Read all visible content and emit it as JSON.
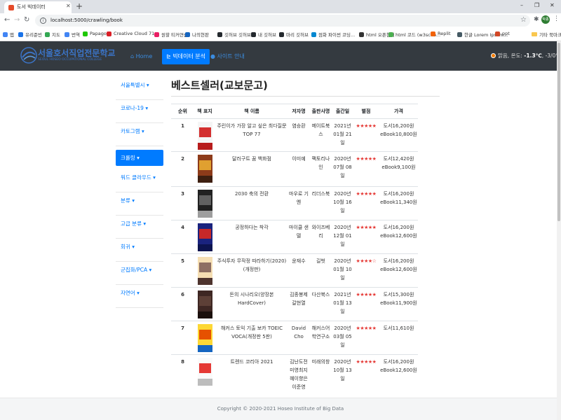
{
  "browser": {
    "tab_title": "도서 빅데이터",
    "url": "localhost:5000/crawling/book",
    "profile_initials": "박종",
    "window_controls": [
      "–",
      "❐",
      "✕"
    ],
    "bookmarks": [
      {
        "label": "앱",
        "color": "#4285f4"
      },
      {
        "label": "유리준빈",
        "color": "#1a73e8"
      },
      {
        "label": "지도",
        "color": "#34a853"
      },
      {
        "label": "번역",
        "color": "#4285f4"
      },
      {
        "label": "Papago",
        "color": "#1ec800"
      },
      {
        "label": "Creative Cloud 71...",
        "color": "#da1f26"
      },
      {
        "label": "원할 티커연습",
        "color": "#e91e63"
      },
      {
        "label": "나의현판",
        "color": "#1565c0"
      },
      {
        "label": "깃허브 깃허브",
        "color": "#24292e"
      },
      {
        "label": "내 깃허브",
        "color": "#24292e"
      },
      {
        "label": "마리 깃허브",
        "color": "#24292e"
      },
      {
        "label": "점화 파이썬 코딩...",
        "color": "#0288d1"
      },
      {
        "label": "html 오픈참서",
        "color": "#333333"
      },
      {
        "label": "html 코드 (w3scho...",
        "color": "#4caf50"
      },
      {
        "label": "Replit",
        "color": "#f26207"
      },
      {
        "label": "한글 Lorem Ipsum...",
        "color": "#455a64"
      },
      {
        "label": "ppt",
        "color": "#d24726"
      },
      {
        "label": "기타 북마크",
        "color": "#f9c74f"
      }
    ]
  },
  "app": {
    "brand_name": "서울호서직업전문학교",
    "brand_sub": "SEOUL HOSEO OCCUPATIONAL COLLEGE",
    "nav": [
      {
        "label": "Home",
        "icon": "home-icon",
        "active": false
      },
      {
        "label": "빅데이터 분석",
        "icon": "chart-icon",
        "active": true
      },
      {
        "label": "사이트 안내",
        "icon": "info-icon",
        "active": false
      }
    ],
    "weather": {
      "prefix": "맑음, 온도:",
      "value": "-1.3℃",
      "range": "-3/0℃"
    }
  },
  "sidebar": {
    "items": [
      {
        "label": "서울특별시",
        "active": false
      },
      {
        "label": "코로나-19",
        "active": false
      },
      {
        "label": "카토그램",
        "active": false
      },
      {
        "label": "크롤링",
        "active": true
      },
      {
        "label": "워드 클라우드",
        "active": false
      },
      {
        "label": "분류",
        "active": false
      },
      {
        "label": "고급 분류",
        "active": false
      },
      {
        "label": "회귀",
        "active": false
      },
      {
        "label": "군집화/PCA",
        "active": false
      },
      {
        "label": "자연어",
        "active": false
      }
    ]
  },
  "main": {
    "title": "베스트셀러(교보문고)",
    "columns": [
      "순위",
      "책 표지",
      "책 이름",
      "저자명",
      "출판사명",
      "출간일",
      "별점",
      "가격"
    ],
    "rows": [
      {
        "rank": "1",
        "title": "주린이가 가장 알고 싶은 최다질문 TOP 77",
        "author": "염승환",
        "publisher": "메이트북스",
        "date": "2021년 01월 21일",
        "stars": "★★★★★",
        "price": "도서16,200원 eBook10,800원",
        "cover_colors": [
          "#f5f5f5",
          "#d32f2f",
          "#b71c1c"
        ]
      },
      {
        "rank": "2",
        "title": "달러구트 꿈 백화점",
        "author": "이미예",
        "publisher": "팩토리나인",
        "date": "2020년 07월 08일",
        "stars": "★★★★★",
        "price": "도서12,420원 eBook9,100원",
        "cover_colors": [
          "#8d3b1a",
          "#e0a030",
          "#3e1f10"
        ]
      },
      {
        "rank": "3",
        "title": "2030 축의 전환",
        "author": "마우로 기옌",
        "publisher": "리더스북",
        "date": "2020년 10월 16일",
        "stars": "★★★★★",
        "price": "도서16,200원 eBook11,340원",
        "cover_colors": [
          "#212121",
          "#616161",
          "#9e9e9e"
        ]
      },
      {
        "rank": "4",
        "title": "공정하다는 착각",
        "author": "마이클 샌델",
        "publisher": "와이즈베리",
        "date": "2020년 12월 01일",
        "stars": "★★★★★",
        "price": "도서16,200원 eBook12,600원",
        "cover_colors": [
          "#1a237e",
          "#c62828",
          "#0d1450"
        ]
      },
      {
        "rank": "5",
        "title": "주식투자 무작정 따라하기(2020)(개정판)",
        "author": "윤재수",
        "publisher": "길벗",
        "date": "2020년 01월 10일",
        "stars": "★★★★☆",
        "price": "도서16,200원 eBook12,600원",
        "cover_colors": [
          "#f5deb3",
          "#8d6e63",
          "#4e342e"
        ]
      },
      {
        "rank": "6",
        "title": "돈의 시나리오(양장본 HardCover)",
        "author": "김종봉제갈현열",
        "publisher": "다산북스",
        "date": "2021년 01월 13일",
        "stars": "★★★★★",
        "price": "도서15,300원 eBook11,900원",
        "cover_colors": [
          "#3e2723",
          "#5d4037",
          "#1b0f0c"
        ]
      },
      {
        "rank": "7",
        "title": "해커스 토익 기출 보카 TOEIC VOCA(개정판 5판)",
        "author": "David Cho",
        "publisher": "해커스어학연구소",
        "date": "2020년 03월 05일",
        "stars": "★★★★★",
        "price": "도서11,610원",
        "cover_colors": [
          "#fdd835",
          "#e65100",
          "#1565c0"
        ]
      },
      {
        "rank": "8",
        "title": "트렌드 코리아 2021",
        "author": "김난도전미영최지혜이향은이준영",
        "publisher": "미래의창",
        "date": "2020년 10월 13일",
        "stars": "★★★★★",
        "price": "도서16,200원 eBook12,600원",
        "cover_colors": [
          "#fafafa",
          "#e53935",
          "#bdbdbd"
        ]
      }
    ]
  },
  "footer": {
    "text": "Copyright © 2020-2021 Hoseo Institute of Big Data"
  },
  "colors": {
    "accent": "#007bff",
    "navbar": "#343a40",
    "stars": "#e53935"
  }
}
